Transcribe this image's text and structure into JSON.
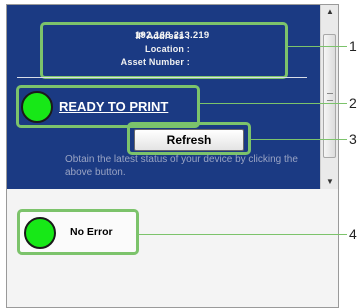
{
  "status": {
    "ip_label": "IP Address :",
    "ip_value": "192.168.213.219",
    "location_label": "Location :",
    "asset_label": "Asset Number :",
    "ready_text": "READY TO PRINT",
    "refresh_label": "Refresh",
    "hint": "Obtain the latest status of your device by clicking the above button."
  },
  "error": {
    "text": "No Error"
  },
  "callouts": [
    "1",
    "2",
    "3",
    "4"
  ],
  "colors": {
    "panel_blue": "#1b3a83",
    "led_green": "#17e817",
    "highlight_green": "#7cc36b"
  }
}
